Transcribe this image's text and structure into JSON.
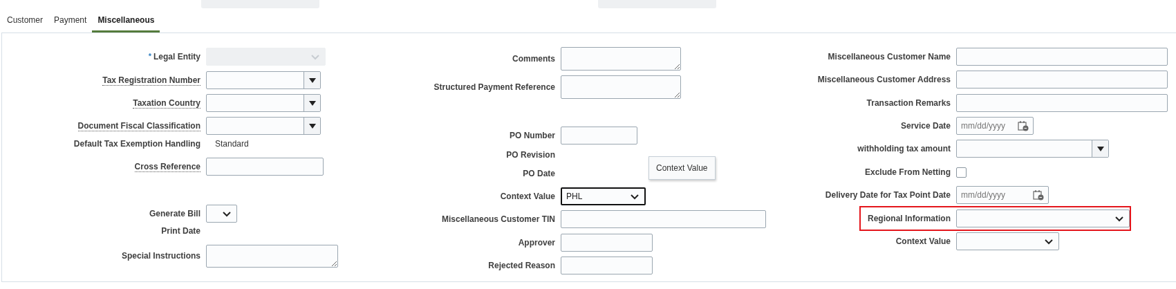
{
  "header_fields": [
    {
      "disabled": true
    },
    {
      "disabled": true
    }
  ],
  "tabs": [
    {
      "label": "Customer",
      "selected": false
    },
    {
      "label": "Payment",
      "selected": false
    },
    {
      "label": "Miscellaneous",
      "selected": true
    }
  ],
  "columns": [
    {
      "fields": [
        {
          "label": "Legal Entity",
          "required_mark": "*",
          "kind": "select",
          "disabled": true
        },
        {
          "label": "Tax Registration Number",
          "help": true,
          "kind": "combo"
        },
        {
          "label": "Taxation Country",
          "help": true,
          "kind": "combo"
        },
        {
          "label": "Document Fiscal Classification",
          "help": true,
          "kind": "combo"
        },
        {
          "label": "Default Tax Exemption Handling",
          "kind": "readonly",
          "value": "Standard"
        },
        {
          "label": "Cross Reference",
          "help": true,
          "kind": "text"
        },
        {
          "label": "Generate Bill",
          "kind": "select"
        },
        {
          "label": "Print Date",
          "kind": "none"
        },
        {
          "label": "Special Instructions",
          "kind": "textarea"
        }
      ]
    },
    {
      "fields": [
        {
          "label": "Comments",
          "kind": "textarea"
        },
        {
          "label": "Structured Payment Reference",
          "kind": "textarea"
        },
        {
          "label": "PO Number",
          "kind": "text"
        },
        {
          "label": "PO Revision",
          "kind": "none"
        },
        {
          "label": "PO Date",
          "kind": "none"
        },
        {
          "label": "Context Value",
          "kind": "select",
          "value": "PHL",
          "focused": true,
          "tooltip": "Context Value"
        },
        {
          "label": "Miscellaneous Customer TIN",
          "kind": "text"
        },
        {
          "label": "Approver",
          "kind": "text"
        },
        {
          "label": "Rejected Reason",
          "kind": "text"
        }
      ]
    },
    {
      "fields": [
        {
          "label": "Miscellaneous Customer Name",
          "kind": "text"
        },
        {
          "label": "Miscellaneous Customer Address",
          "kind": "text"
        },
        {
          "label": "Transaction Remarks",
          "kind": "text"
        },
        {
          "label": "Service Date",
          "kind": "date",
          "placeholder": "mm/dd/yyyy"
        },
        {
          "label": "withholding tax amount",
          "kind": "combo"
        },
        {
          "label": "Exclude From Netting",
          "kind": "checkbox",
          "checked": false
        },
        {
          "label": "Delivery Date for Tax Point Date",
          "kind": "date",
          "placeholder": "mm/dd/yyyy"
        },
        {
          "label": "Regional Information",
          "kind": "select",
          "highlighted": true
        },
        {
          "label": "Context Value",
          "kind": "select"
        }
      ]
    }
  ]
}
